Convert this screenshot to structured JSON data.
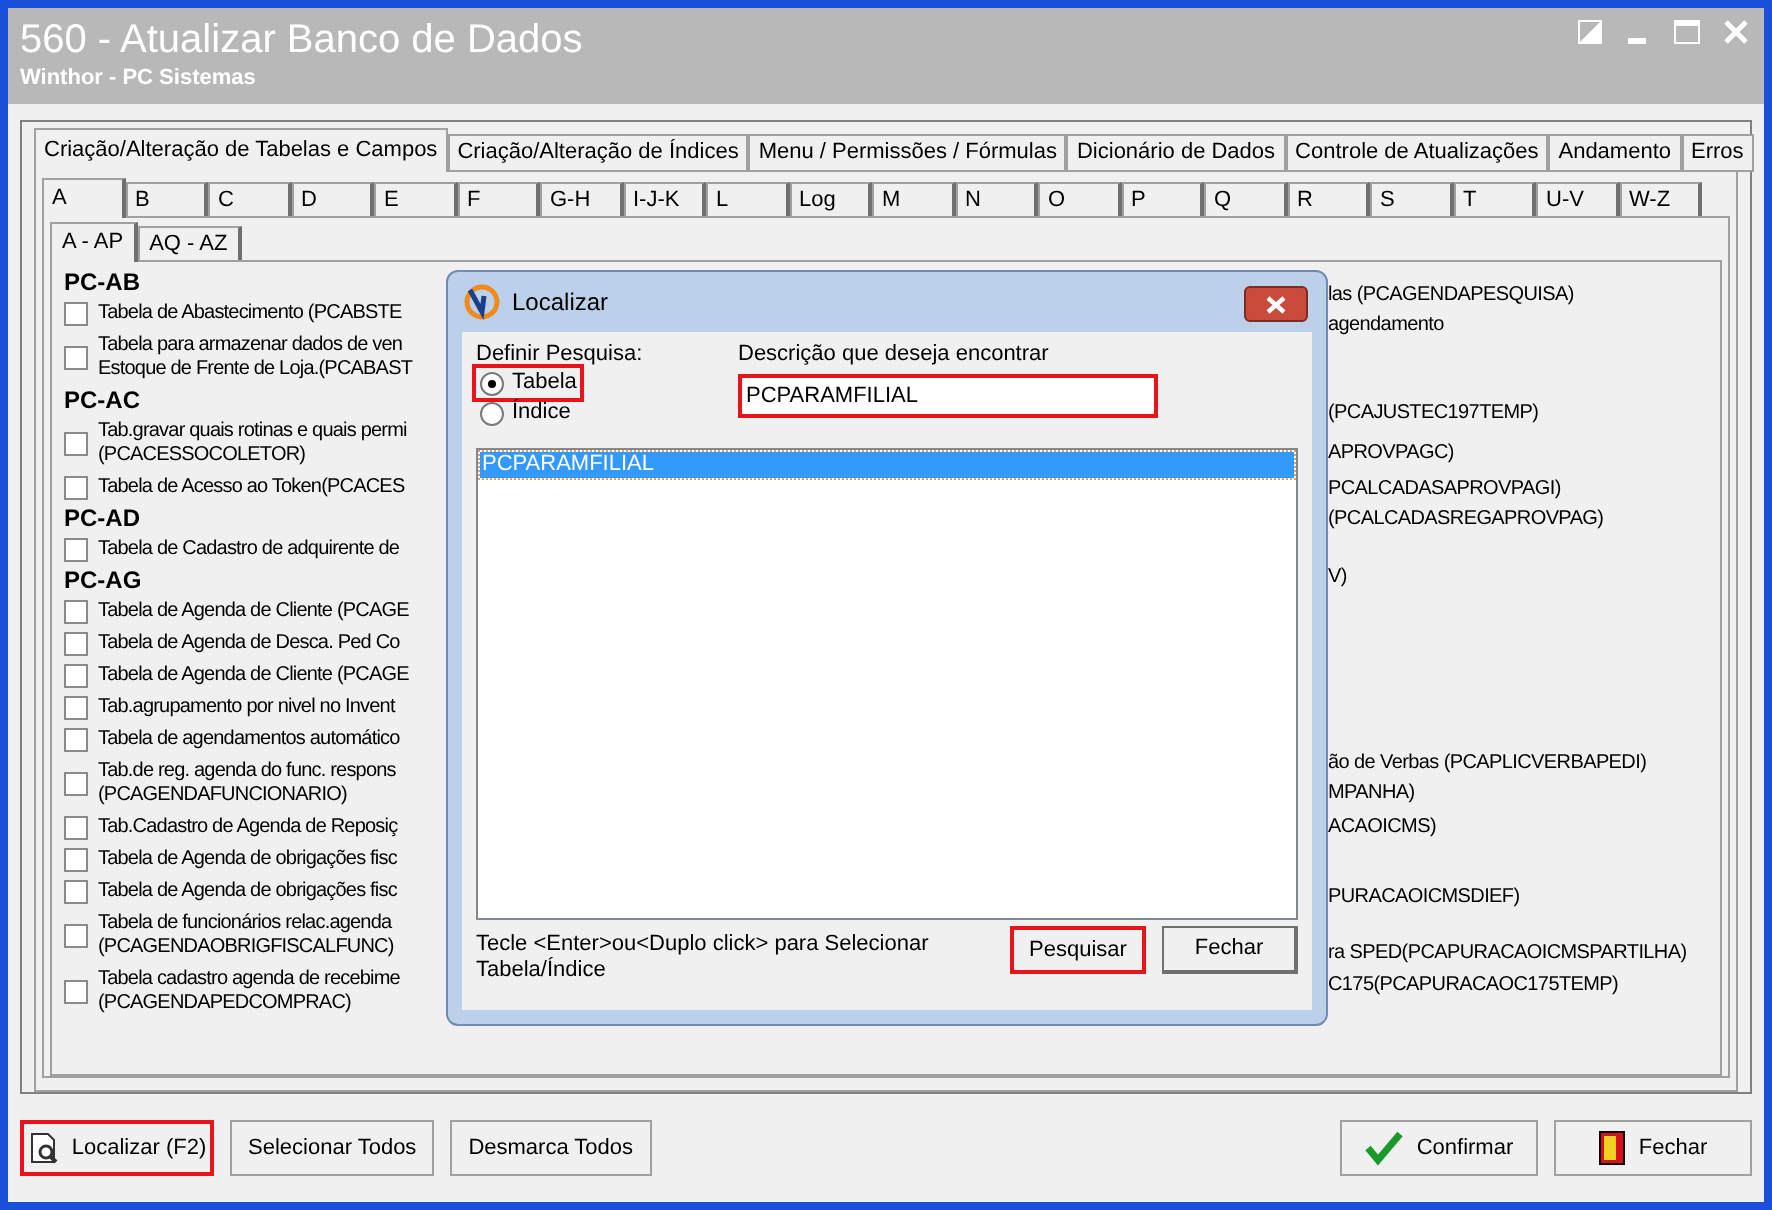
{
  "window": {
    "title": "560 - Atualizar Banco de Dados",
    "subtitle": "Winthor - PC Sistemas"
  },
  "tabs": [
    {
      "label": "Criação/Alteração de Tabelas e Campos",
      "selected": true
    },
    {
      "label": "Criação/Alteração de Índices",
      "selected": false
    },
    {
      "label": "Menu / Permissões / Fórmulas",
      "selected": false
    },
    {
      "label": "Dicionário de Dados",
      "selected": false
    },
    {
      "label": "Controle de Atualizações",
      "selected": false
    },
    {
      "label": "Andamento",
      "selected": false
    },
    {
      "label": "Erros",
      "selected": false
    }
  ],
  "letter_tabs": [
    {
      "label": "A",
      "selected": true
    },
    {
      "label": "B",
      "selected": false
    },
    {
      "label": "C",
      "selected": false
    },
    {
      "label": "D",
      "selected": false
    },
    {
      "label": "E",
      "selected": false
    },
    {
      "label": "F",
      "selected": false
    },
    {
      "label": "G-H",
      "selected": false
    },
    {
      "label": "I-J-K",
      "selected": false
    },
    {
      "label": "L",
      "selected": false
    },
    {
      "label": "Log",
      "selected": false
    },
    {
      "label": "M",
      "selected": false
    },
    {
      "label": "N",
      "selected": false
    },
    {
      "label": "O",
      "selected": false
    },
    {
      "label": "P",
      "selected": false
    },
    {
      "label": "Q",
      "selected": false
    },
    {
      "label": "R",
      "selected": false
    },
    {
      "label": "S",
      "selected": false
    },
    {
      "label": "T",
      "selected": false
    },
    {
      "label": "U-V",
      "selected": false
    },
    {
      "label": "W-Z",
      "selected": false
    }
  ],
  "sub_tabs": [
    {
      "label": "A - AP",
      "selected": true
    },
    {
      "label": "AQ - AZ",
      "selected": false
    }
  ],
  "table_list": [
    {
      "kind": "group",
      "label": "PC-AB"
    },
    {
      "kind": "item",
      "checked": false,
      "lines": [
        "Tabela de Abastecimento (PCABSTE"
      ]
    },
    {
      "kind": "item",
      "checked": false,
      "lines": [
        "Tabela para armazenar dados de ven",
        "Estoque de Frente de Loja.(PCABAST"
      ]
    },
    {
      "kind": "group",
      "label": "PC-AC"
    },
    {
      "kind": "item",
      "checked": false,
      "lines": [
        "Tab.gravar quais rotinas e quais permi",
        "(PCACESSOCOLETOR)"
      ]
    },
    {
      "kind": "item",
      "checked": false,
      "lines": [
        "Tabela de Acesso ao Token(PCACES"
      ]
    },
    {
      "kind": "group",
      "label": "PC-AD"
    },
    {
      "kind": "item",
      "checked": false,
      "lines": [
        "Tabela de Cadastro de adquirente de"
      ]
    },
    {
      "kind": "group",
      "label": "PC-AG"
    },
    {
      "kind": "item",
      "checked": false,
      "lines": [
        "Tabela  de Agenda de Cliente (PCAGE"
      ]
    },
    {
      "kind": "item",
      "checked": false,
      "lines": [
        "Tabela  de Agenda de Desca. Ped Co"
      ]
    },
    {
      "kind": "item",
      "checked": false,
      "lines": [
        "Tabela  de Agenda de Cliente (PCAGE"
      ]
    },
    {
      "kind": "item",
      "checked": false,
      "lines": [
        "Tab.agrupamento por nivel no Invent"
      ]
    },
    {
      "kind": "item",
      "checked": false,
      "lines": [
        "Tabela de agendamentos automático"
      ]
    },
    {
      "kind": "item",
      "checked": false,
      "lines": [
        "Tab.de reg. agenda do func. respons",
        "(PCAGENDAFUNCIONARIO)"
      ]
    },
    {
      "kind": "item",
      "checked": false,
      "lines": [
        "Tab.Cadastro de Agenda de Reposiç"
      ]
    },
    {
      "kind": "item",
      "checked": false,
      "lines": [
        "Tabela de Agenda de obrigações fisc"
      ]
    },
    {
      "kind": "item",
      "checked": false,
      "lines": [
        "Tabela de Agenda de obrigações fisc"
      ]
    },
    {
      "kind": "item",
      "checked": false,
      "lines": [
        "Tabela de funcionários relac.agenda",
        "(PCAGENDAOBRIGFISCALFUNC)"
      ]
    },
    {
      "kind": "item",
      "checked": false,
      "lines": [
        "Tabela cadastro agenda de recebime",
        "(PCAGENDAPEDCOMPRAC)"
      ]
    }
  ],
  "table_list_column_2": [
    "las (PCAGENDAPESQUISA)",
    "agendamento",
    "(PCAJUSTEC197TEMP)",
    "APROVPAGC)",
    "PCALCADASAPROVPAGI)",
    "(PCALCADASREGAPROVPAG)",
    "V)",
    "ão de Verbas (PCAPLICVERBAPEDI)",
    "MPANHA)",
    "ACAOICMS)",
    "PURACAOICMSDIEF)",
    "ra SPED(PCAPURACAOICMSPARTILHA)",
    "C175(PCAPURACAOC175TEMP)"
  ],
  "dialog": {
    "title": "Localizar",
    "search_type_label": "Definir Pesquisa:",
    "search_types": [
      {
        "label": "Tabela",
        "selected": true,
        "highlighted": true
      },
      {
        "label": "Índice",
        "selected": false,
        "highlighted": false
      }
    ],
    "description_label": "Descrição que deseja encontrar",
    "description": {
      "value": "PCPARAMFILIAL",
      "highlighted": true
    },
    "results": [
      {
        "label": "PCPARAMFILIAL",
        "selected": true
      }
    ],
    "hint": [
      "Tecle <Enter>ou<Duplo click> para Selecionar",
      "Tabela/Índice"
    ],
    "buttons": [
      {
        "label": "Pesquisar",
        "highlighted": true
      },
      {
        "label": "Fechar",
        "highlighted": false
      }
    ]
  },
  "footer_buttons": [
    {
      "kind": "search",
      "label": "Localizar (F2)",
      "highlighted": true
    },
    {
      "kind": "plain",
      "label": "Selecionar Todos",
      "highlighted": false
    },
    {
      "kind": "plain",
      "label": "Desmarca Todos",
      "highlighted": false
    },
    {
      "kind": "confirm",
      "label": "Confirmar",
      "highlighted": false
    },
    {
      "kind": "exit",
      "label": "Fechar",
      "highlighted": false
    }
  ]
}
